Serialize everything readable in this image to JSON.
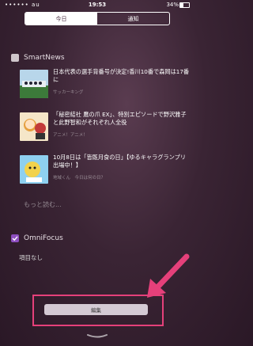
{
  "status_bar": {
    "carrier": "•••••• au",
    "time": "19:53",
    "battery": "34%"
  },
  "segments": {
    "today": "今日",
    "notifications": "通知"
  },
  "widgets": {
    "smartnews": {
      "title": "SmartNews",
      "icon": "smartnews-icon",
      "items": [
        {
          "headline": "日本代表の選手背番号が決定!香川10番で森岡は17番に",
          "source": "サッカーキング"
        },
        {
          "headline": "「秘密結社 鷹の爪 EX」、特別エピソードで野沢雅子と此野智和がそれぞれ人全役",
          "source": "アニメ！アニメ！"
        },
        {
          "headline": "10月8日は「皆既月食の日」【ゆるキャラグランプリ出場中！】",
          "source": "地域くん　今日は何の日？"
        }
      ],
      "more": "もっと読む..."
    },
    "omnifocus": {
      "title": "OmniFocus",
      "icon": "omnifocus-icon",
      "empty": "項目なし"
    }
  },
  "edit_button": "編集",
  "colors": {
    "highlight": "#e5407a",
    "omnifocus": "#8e4fc0"
  }
}
